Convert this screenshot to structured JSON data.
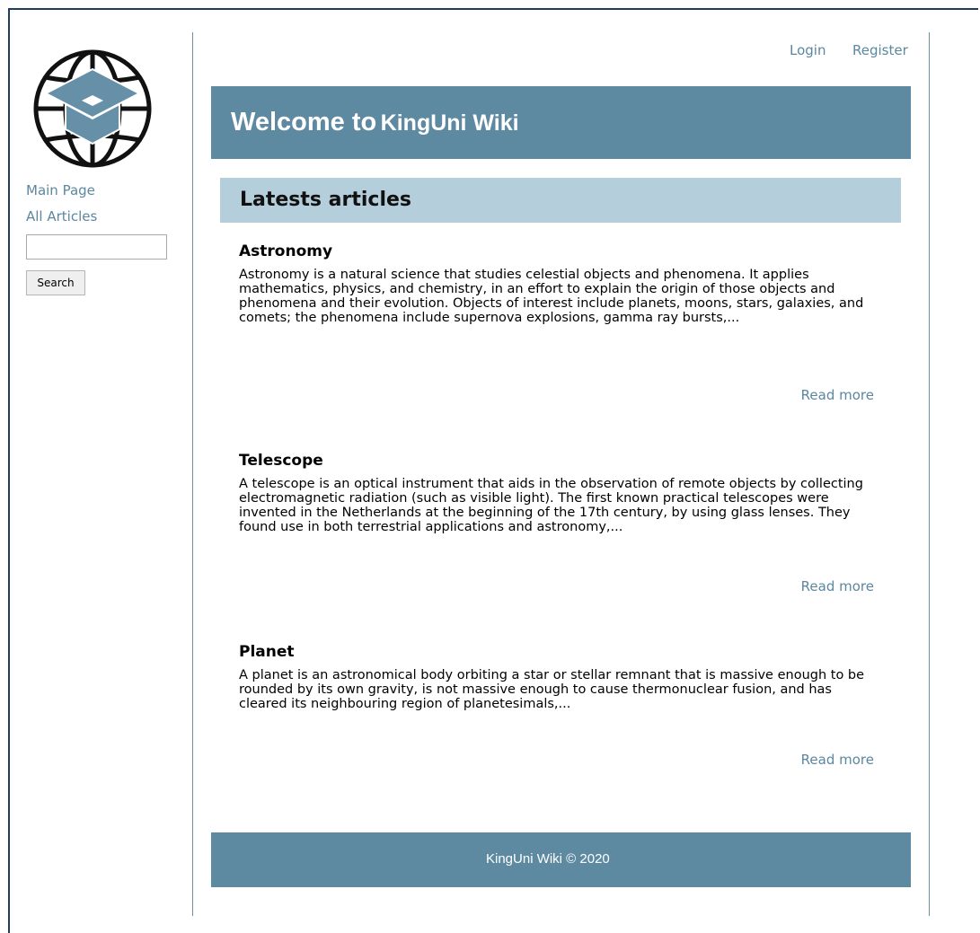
{
  "sidebar": {
    "logo_icon": "globe-with-graduation-cap-icon",
    "links": [
      {
        "label": "Main Page"
      },
      {
        "label": "All Articles"
      }
    ],
    "search": {
      "placeholder": "",
      "value": "",
      "button_label": "Search"
    }
  },
  "topnav": {
    "login": "Login",
    "register": "Register"
  },
  "banner": {
    "welcome": "Welcome to",
    "site": "KingUni Wiki"
  },
  "section": {
    "title": "Latests articles"
  },
  "articles": [
    {
      "title": "Astronomy",
      "body": "Astronomy is a natural science that studies celestial objects and phenomena. It applies mathematics, physics, and chemistry, in an effort to explain the origin of those objects and phenomena and their evolution. Objects of interest include planets, moons, stars, galaxies, and comets; the phenomena include supernova explosions, gamma ray bursts,...",
      "read_more": "Read more"
    },
    {
      "title": "Telescope",
      "body": "A telescope is an optical instrument that aids in the observation of remote objects by collecting electromagnetic radiation (such as visible light). The first known practical telescopes were invented in the Netherlands at the beginning of the 17th century, by using glass lenses. They found use in both terrestrial applications and astronomy,...",
      "read_more": "Read more"
    },
    {
      "title": "Planet",
      "body": "A planet is an astronomical body orbiting a star or stellar remnant that is massive enough to be rounded by its own gravity, is not massive enough to cause thermonuclear fusion, and has cleared its neighbouring region of planetesimals,...",
      "read_more": "Read more"
    }
  ],
  "footer": {
    "text": "KingUni Wiki © 2020"
  },
  "colors": {
    "primary": "#5e8aa1",
    "section_bg": "#b5cedb",
    "link": "#5b87a0",
    "frame": "#1f3f5f"
  }
}
